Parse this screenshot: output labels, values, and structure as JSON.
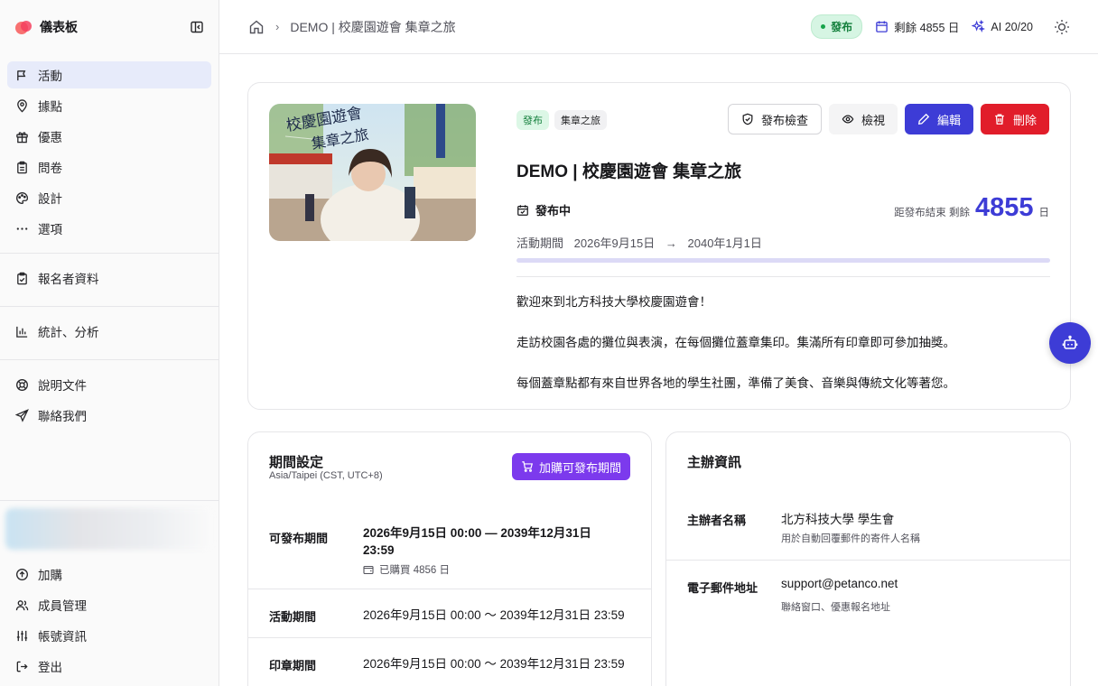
{
  "brand": {
    "title": "儀表板",
    "accent": "#3d3cd6"
  },
  "nav": {
    "main": [
      {
        "label": "活動",
        "icon": "flag-icon",
        "active": true
      },
      {
        "label": "據點",
        "icon": "map-pin-icon"
      },
      {
        "label": "優惠",
        "icon": "gift-icon"
      },
      {
        "label": "問卷",
        "icon": "clipboard-icon"
      },
      {
        "label": "設計",
        "icon": "palette-icon"
      },
      {
        "label": "選項",
        "icon": "more-icon"
      }
    ],
    "registrants": "報名者資料",
    "stats": "統計、分析",
    "docs": "說明文件",
    "contact": "聯絡我們",
    "bottom": [
      {
        "label": "加購"
      },
      {
        "label": "成員管理"
      },
      {
        "label": "帳號資訊"
      },
      {
        "label": "登出"
      }
    ]
  },
  "topbar": {
    "breadcrumb": "DEMO | 校慶園遊會 集章之旅",
    "status": "發布",
    "remaining": "剩餘 4855 日",
    "ai": "AI 20/20"
  },
  "hero": {
    "image_alt": "校慶園遊會 集章之旅",
    "image_text": "校慶園遊會\n集章之旅",
    "badges": [
      "發布",
      "集章之旅"
    ],
    "actions": {
      "check": "發布檢查",
      "view": "檢視",
      "edit": "編輯",
      "delete": "刪除"
    },
    "title": "DEMO | 校慶園遊會 集章之旅",
    "status": "發布中",
    "remain_prefix": "距發布結束 剩餘",
    "remain_days": "4855",
    "remain_unit": "日",
    "period_label": "活動期間",
    "period_start": "2026年9月15日",
    "period_arrow": "→",
    "period_end": "2040年1月1日",
    "progress_fraction": 0.0,
    "description": [
      "歡迎來到北方科技大學校慶園遊會！",
      "走訪校園各處的攤位與表演，在每個攤位蓋章集印。集滿所有印章即可參加抽獎。",
      "每個蓋章點都有來自世界各地的學生社團，準備了美食、音樂與傳統文化等著您。"
    ]
  },
  "period_settings": {
    "title": "期間設定",
    "timezone": "Asia/Taipei (CST, UTC+8)",
    "buy_button": "加購可發布期間",
    "rows": [
      {
        "label": "可發布期間",
        "value": "2026年9月15日 00:00 — 2039年12月31日 23:59",
        "note": "已購買 4856 日"
      },
      {
        "label": "活動期間",
        "value": "2026年9月15日 00:00 〜 2039年12月31日 23:59"
      },
      {
        "label": "印章期間",
        "value": "2026年9月15日 00:00 〜 2039年12月31日 23:59"
      }
    ]
  },
  "organizer": {
    "title": "主辦資訊",
    "rows": [
      {
        "label": "主辦者名稱",
        "value": "北方科技大學 學生會",
        "note": "用於自動回覆郵件的寄件人名稱"
      },
      {
        "label": "電子郵件地址",
        "value": "support@petanco.net",
        "note": "聯絡窗口、優惠報名地址"
      }
    ]
  }
}
